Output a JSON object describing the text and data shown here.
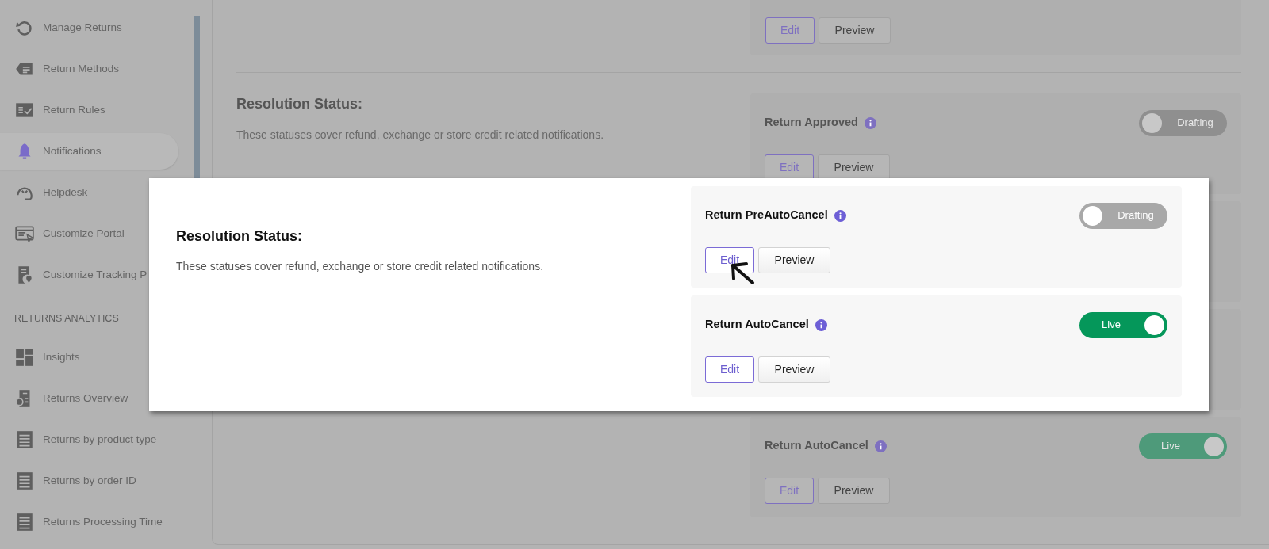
{
  "sidebar": {
    "items": [
      {
        "kind": "link",
        "label": "Manage Returns",
        "selected": false
      },
      {
        "kind": "link",
        "label": "Return Methods",
        "selected": false
      },
      {
        "kind": "link",
        "label": "Return Rules",
        "selected": false
      },
      {
        "kind": "link",
        "label": "Notifications",
        "selected": true
      },
      {
        "kind": "link",
        "label": "Helpdesk",
        "selected": false
      },
      {
        "kind": "link",
        "label": "Customize Portal",
        "selected": false
      },
      {
        "kind": "link",
        "label": "Customize Tracking P",
        "selected": false
      },
      {
        "kind": "header",
        "label": "RETURNS ANALYTICS"
      },
      {
        "kind": "link",
        "label": "Insights",
        "selected": false
      },
      {
        "kind": "link",
        "label": "Returns Overview",
        "selected": false
      },
      {
        "kind": "link",
        "label": "Returns by product type",
        "selected": false
      },
      {
        "kind": "link",
        "label": "Returns by order ID",
        "selected": false
      },
      {
        "kind": "link",
        "label": "Returns Processing Time",
        "selected": false
      }
    ]
  },
  "background": {
    "top_card": {
      "buttons": [
        "Edit",
        "Preview"
      ]
    },
    "section": {
      "title": "Resolution Status:",
      "description": "These statuses cover refund, exchange or store credit related notifications."
    },
    "cards": [
      {
        "title": "Return Approved",
        "status": {
          "label": "Drafting",
          "on": false
        },
        "buttons": [
          "Edit",
          "Preview"
        ]
      },
      {
        "title": "Return AutoCancel",
        "status": {
          "label": "Live",
          "on": true
        },
        "buttons": [
          "Edit",
          "Preview"
        ]
      }
    ]
  },
  "popup": {
    "section": {
      "title": "Resolution Status:",
      "description": "These statuses cover refund, exchange or store credit related notifications."
    },
    "cards": [
      {
        "title": "Return PreAutoCancel",
        "status": {
          "label": "Drafting",
          "on": false
        },
        "buttons": [
          "Edit",
          "Preview"
        ]
      },
      {
        "title": "Return AutoCancel",
        "status": {
          "label": "Live",
          "on": true
        },
        "buttons": [
          "Edit",
          "Preview"
        ]
      }
    ]
  }
}
